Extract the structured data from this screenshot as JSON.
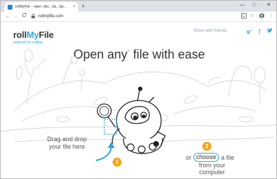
{
  "browser": {
    "tab_title": "rollMyFile – open .doc, .xls, .zip...",
    "tab_close": "×",
    "new_tab": "+",
    "url": "rollmyfile.com",
    "lock": "🔒",
    "back": "←",
    "forward": "→",
    "reload": "C",
    "window_min": "—",
    "window_max": "□",
    "window_close": "✕",
    "toolbar_icons": [
      "translate-icon",
      "star-icon",
      "account-icon",
      "menu-icon"
    ]
  },
  "header": {
    "logo_prefix": "roll",
    "logo_mid": "My",
    "logo_suffix": "File",
    "powered_by": "powered by rollApp",
    "share_label": "Share with friends:"
  },
  "main": {
    "headline": "Open any",
    "headline_sup": "*",
    "headline_rest": " file with ease",
    "step1_number": "1",
    "step1_text_line1": "Drag and drop",
    "step1_text_line2": "your file here",
    "step2_number": "2",
    "step2_prefix": "or",
    "choose_button": "choose",
    "step2_suffix": "a file",
    "step2_line2": "from your computer"
  },
  "colors": {
    "accent_blue": "#29a8e0",
    "badge_orange": "#f3a51b"
  }
}
